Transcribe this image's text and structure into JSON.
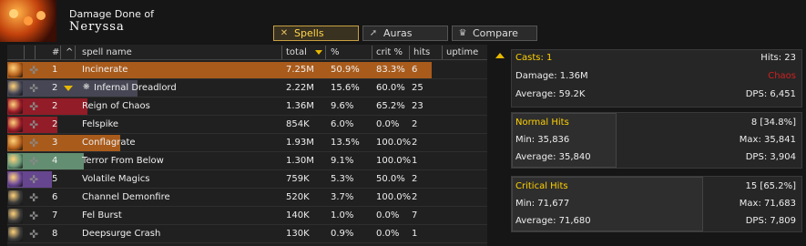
{
  "header": {
    "subtitle": "Damage Done of",
    "player": "Neryssa"
  },
  "tabs": [
    {
      "label": "Spells",
      "icon": "spellbook-icon",
      "active": true
    },
    {
      "label": "Auras",
      "icon": "aura-icon",
      "active": false
    },
    {
      "label": "Compare",
      "icon": "crown-icon",
      "active": false
    }
  ],
  "columns": {
    "num": "#",
    "sort": "^",
    "spell": "spell name",
    "total": "total",
    "pct": "%",
    "crit": "crit %",
    "hits": "hits",
    "uptime": "uptime"
  },
  "rows": [
    {
      "num": "1",
      "name": "Incinerate",
      "total": "7.25M",
      "pct": "50.9%",
      "crit": "83.3%",
      "hits": "6",
      "color": "#b8621b",
      "bar": 1.0
    },
    {
      "num": "2",
      "name": "Infernal Dreadlord",
      "total": "2.22M",
      "pct": "15.6%",
      "crit": "60.0%",
      "hits": "25",
      "color": "#4a4a5a",
      "bar": 0.307
    },
    {
      "num": "2",
      "name": "Reign of Chaos",
      "total": "1.36M",
      "pct": "9.6%",
      "crit": "65.2%",
      "hits": "23",
      "color": "#9e1c28",
      "bar": 0.188
    },
    {
      "num": "2",
      "name": "Felspike",
      "total": "854K",
      "pct": "6.0%",
      "crit": "0.0%",
      "hits": "2",
      "color": "#9e1c28",
      "bar": 0.118
    },
    {
      "num": "3",
      "name": "Conflagrate",
      "total": "1.93M",
      "pct": "13.5%",
      "crit": "100.0%",
      "hits": "2",
      "color": "#b8621b",
      "bar": 0.266
    },
    {
      "num": "4",
      "name": "Terror From Below",
      "total": "1.30M",
      "pct": "9.1%",
      "crit": "100.0%",
      "hits": "1",
      "color": "#6a9a7a",
      "bar": 0.18
    },
    {
      "num": "5",
      "name": "Volatile Magics",
      "total": "759K",
      "pct": "5.3%",
      "crit": "50.0%",
      "hits": "2",
      "color": "#6e4a9a",
      "bar": 0.105
    },
    {
      "num": "6",
      "name": "Channel Demonfire",
      "total": "520K",
      "pct": "3.7%",
      "crit": "100.0%",
      "hits": "2",
      "color": "#3a3a3a",
      "bar": 0.0
    },
    {
      "num": "7",
      "name": "Fel Burst",
      "total": "140K",
      "pct": "1.0%",
      "crit": "0.0%",
      "hits": "7",
      "color": "#3a3a3a",
      "bar": 0.0
    },
    {
      "num": "8",
      "name": "Deepsurge Crash",
      "total": "130K",
      "pct": "0.9%",
      "crit": "0.0%",
      "hits": "1",
      "color": "#3a3a3a",
      "bar": 0.0
    }
  ],
  "casts": {
    "label": "Casts: 1",
    "hits": "Hits: 23",
    "damage": "Damage: 1.36M",
    "school": "Chaos",
    "average": "Average: 59.2K",
    "dps": "DPS: 6,451"
  },
  "normal": {
    "title": "Normal Hits",
    "count": "8 [34.8%]",
    "min": "Min: 35,836",
    "max": "Max: 35,841",
    "average": "Average: 35,840",
    "dps": "DPS: 3,904"
  },
  "critical": {
    "title": "Critical Hits",
    "count": "15 [65.2%]",
    "min": "Min: 71,677",
    "max": "Max: 71,683",
    "average": "Average: 71,680",
    "dps": "DPS: 7,809"
  }
}
